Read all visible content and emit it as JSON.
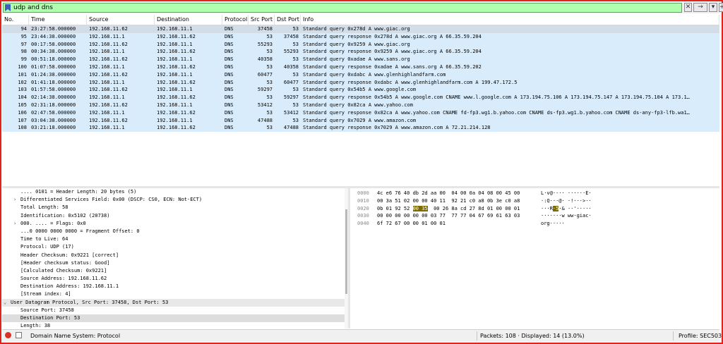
{
  "filter": {
    "value": "udp and dns"
  },
  "columns": [
    "No.",
    "Time",
    "Source",
    "Destination",
    "Protocol",
    "Src Port",
    "Dst Port",
    "Info"
  ],
  "packets": [
    {
      "no": "94",
      "time": "23:27:58.000000",
      "src": "192.168.11.62",
      "dst": "192.168.11.1",
      "proto": "DNS",
      "sport": "37458",
      "dport": "53",
      "info": "Standard query 0x278d A www.giac.org"
    },
    {
      "no": "95",
      "time": "23:44:38.000000",
      "src": "192.168.11.1",
      "dst": "192.168.11.62",
      "proto": "DNS",
      "sport": "53",
      "dport": "37458",
      "info": "Standard query response 0x278d A www.giac.org A 66.35.59.204"
    },
    {
      "no": "97",
      "time": "00:17:58.000000",
      "src": "192.168.11.62",
      "dst": "192.168.11.1",
      "proto": "DNS",
      "sport": "55293",
      "dport": "53",
      "info": "Standard query 0x9259 A www.giac.org"
    },
    {
      "no": "98",
      "time": "00:34:38.000000",
      "src": "192.168.11.1",
      "dst": "192.168.11.62",
      "proto": "DNS",
      "sport": "53",
      "dport": "55293",
      "info": "Standard query response 0x9259 A www.giac.org A 66.35.59.204"
    },
    {
      "no": "99",
      "time": "00:51:18.000000",
      "src": "192.168.11.62",
      "dst": "192.168.11.1",
      "proto": "DNS",
      "sport": "40358",
      "dport": "53",
      "info": "Standard query 0xadae A www.sans.org"
    },
    {
      "no": "100",
      "time": "01:07:58.000000",
      "src": "192.168.11.1",
      "dst": "192.168.11.62",
      "proto": "DNS",
      "sport": "53",
      "dport": "40358",
      "info": "Standard query response 0xadae A www.sans.org A 66.35.59.202"
    },
    {
      "no": "101",
      "time": "01:24:38.000000",
      "src": "192.168.11.62",
      "dst": "192.168.11.1",
      "proto": "DNS",
      "sport": "60477",
      "dport": "53",
      "info": "Standard query 0xdabc A www.glenhighlandfarm.com"
    },
    {
      "no": "102",
      "time": "01:41:18.000000",
      "src": "192.168.11.1",
      "dst": "192.168.11.62",
      "proto": "DNS",
      "sport": "53",
      "dport": "60477",
      "info": "Standard query response 0xdabc A www.glenhighlandfarm.com A 199.47.172.5"
    },
    {
      "no": "103",
      "time": "01:57:58.000000",
      "src": "192.168.11.62",
      "dst": "192.168.11.1",
      "proto": "DNS",
      "sport": "59297",
      "dport": "53",
      "info": "Standard query 0x54b5 A www.google.com"
    },
    {
      "no": "104",
      "time": "02:14:38.000000",
      "src": "192.168.11.1",
      "dst": "192.168.11.62",
      "proto": "DNS",
      "sport": "53",
      "dport": "59297",
      "info": "Standard query response 0x54b5 A www.google.com CNAME www.l.google.com A 173.194.75.106 A 173.194.75.147 A 173.194.75.104 A 173.1…"
    },
    {
      "no": "105",
      "time": "02:31:18.000000",
      "src": "192.168.11.62",
      "dst": "192.168.11.1",
      "proto": "DNS",
      "sport": "53412",
      "dport": "53",
      "info": "Standard query 0x82ca A www.yahoo.com"
    },
    {
      "no": "106",
      "time": "02:47:58.000000",
      "src": "192.168.11.1",
      "dst": "192.168.11.62",
      "proto": "DNS",
      "sport": "53",
      "dport": "53412",
      "info": "Standard query response 0x82ca A www.yahoo.com CNAME fd-fp3.wg1.b.yahoo.com CNAME ds-fp3.wg1.b.yahoo.com CNAME ds-any-fp3-lfb.wa1…"
    },
    {
      "no": "107",
      "time": "03:04:38.000000",
      "src": "192.168.11.62",
      "dst": "192.168.11.1",
      "proto": "DNS",
      "sport": "47488",
      "dport": "53",
      "info": "Standard query 0x7029 A www.amazon.com"
    },
    {
      "no": "108",
      "time": "03:21:18.000000",
      "src": "192.168.11.1",
      "dst": "192.168.11.62",
      "proto": "DNS",
      "sport": "53",
      "dport": "47488",
      "info": "Standard query response 0x7029 A www.amazon.com A 72.21.214.128"
    }
  ],
  "details": [
    {
      "text": ".... 0101 = Header Length: 20 bytes (5)",
      "indent": 2,
      "exp": ""
    },
    {
      "text": "Differentiated Services Field: 0x00 (DSCP: CS0, ECN: Not-ECT)",
      "indent": 2,
      "exp": ">"
    },
    {
      "text": "Total Length: 58",
      "indent": 2,
      "exp": ""
    },
    {
      "text": "Identification: 0x5102 (20738)",
      "indent": 2,
      "exp": ""
    },
    {
      "text": "000. .... = Flags: 0x0",
      "indent": 2,
      "exp": ">"
    },
    {
      "text": "...0 0000 0000 0000 = Fragment Offset: 0",
      "indent": 2,
      "exp": ""
    },
    {
      "text": "Time to Live: 64",
      "indent": 2,
      "exp": ""
    },
    {
      "text": "Protocol: UDP (17)",
      "indent": 2,
      "exp": ""
    },
    {
      "text": "Header Checksum: 0x9221 [correct]",
      "indent": 2,
      "exp": ""
    },
    {
      "text": "[Header checksum status: Good]",
      "indent": 2,
      "exp": ""
    },
    {
      "text": "[Calculated Checksum: 0x9221]",
      "indent": 2,
      "exp": ""
    },
    {
      "text": "Source Address: 192.168.11.62",
      "indent": 2,
      "exp": ""
    },
    {
      "text": "Destination Address: 192.168.11.1",
      "indent": 2,
      "exp": ""
    },
    {
      "text": "[Stream index: 4]",
      "indent": 2,
      "exp": ""
    },
    {
      "text": "User Datagram Protocol, Src Port: 37458, Dst Port: 53",
      "indent": 1,
      "exp": "v"
    },
    {
      "text": "Source Port: 37458",
      "indent": 2,
      "exp": ""
    },
    {
      "text": "Destination Port: 53",
      "indent": 2,
      "exp": ""
    },
    {
      "text": "Length: 38",
      "indent": 2,
      "exp": ""
    }
  ],
  "bytes": [
    {
      "off": "0000",
      "hex1": "4c e6 76 40 db 2d aa 00",
      "hex2": "04 00 0a 04 08 00 45 00",
      "asc": "L·v@·-·· ······E·"
    },
    {
      "off": "0010",
      "hex1": "00 3a 51 02 00 00 40 11",
      "hex2": "92 21 c0 a8 0b 3e c0 a8",
      "asc": "·:Q···@· ·!···>··"
    },
    {
      "off": "0020",
      "hex1a": "0b 01 92 52 ",
      "hexhl": "00 35",
      "hex1b": "",
      "hex2": "00 26 8a cd 27 8d 01 00 00 01",
      "asc1": "···R",
      "aschl": "·5",
      "asc2": "·& ··'·····"
    },
    {
      "off": "0030",
      "hex1": "00 00 00 00 00 00 03 77",
      "hex2": "77 77 04 67 69 61 63 03",
      "asc": "·······w ww·giac·"
    },
    {
      "off": "0040",
      "hex1": "6f 72 67 00 00 01 00 01",
      "hex2": "",
      "asc": "org·····"
    }
  ],
  "status": {
    "field": "Domain Name System: Protocol",
    "packets": "Packets: 108 · Displayed: 14 (13.0%)",
    "profile": "Profile: SEC503"
  },
  "colors": {
    "row_bg": "#d8ecfb",
    "filter_ok": "#afffaf",
    "frame": "#e0241c"
  }
}
